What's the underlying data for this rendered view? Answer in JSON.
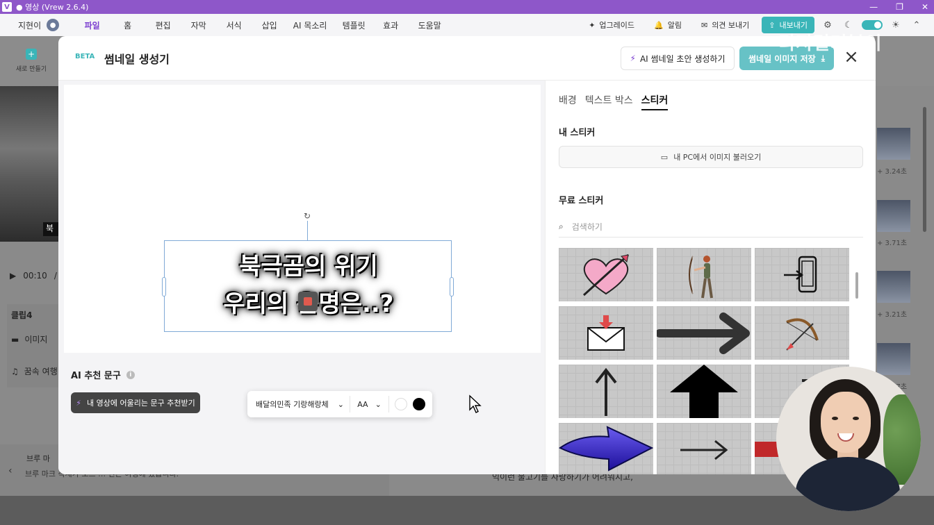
{
  "window": {
    "title": "● 영상 (Vrew 2.6.4)",
    "app_icon": "V"
  },
  "menubar": {
    "user_name": "지현이",
    "menus": [
      "파일",
      "홈",
      "편집",
      "자막",
      "서식",
      "삽입",
      "AI 목소리",
      "템플릿",
      "효과",
      "도움말"
    ],
    "active_menu": "파일",
    "upgrade": "업그레이드",
    "notify": "알림",
    "feedback": "의견 보내기",
    "export": "내보내기"
  },
  "watermark": "디지털거북이",
  "background": {
    "new_label": "새로 만들기",
    "play_time": "00:10",
    "play_sep": "/",
    "video_caption": "북",
    "clip_title": "클립4",
    "clip_image": "이미지",
    "clip_music": "꿈속 여행",
    "bottom_title": "브루 마",
    "bottom_text": "브루 마크 삭제가 모드 … 인근 여행에 있습니다.",
    "right_text": "익이런 불고기를 사랑하기가 어려워지고,",
    "durations": [
      "+ 3.24초",
      "+ 3.71초",
      "+ 3.21초",
      "+ 3.27초"
    ]
  },
  "modal": {
    "beta": "BETA",
    "title": "썸네일 생성기",
    "ai_draft_label": "AI 썸네일 초안 생성하기",
    "save_label": "썸네일 이미지 저장",
    "thumbnail_text": [
      "북극곰의 위기",
      "우리의 운명은..?"
    ],
    "font_name": "배달의민족 기랑해랑체",
    "size_label": "AA",
    "text_color": "#ffffff",
    "stroke_color": "#000000",
    "ai_section_label": "AI 추천 문구",
    "ai_suggest_label": "내 영상에 어울리는 문구 추천받기"
  },
  "side_panel": {
    "tabs": [
      "배경",
      "텍스트 박스",
      "스티커"
    ],
    "active_tab": "스티커",
    "my_stickers_title": "내 스티커",
    "load_from_pc": "내 PC에서 이미지 불러오기",
    "free_stickers_title": "무료 스티커",
    "search_placeholder": "검색하기",
    "stickers": [
      "heart-arrow-sticker",
      "archer-sticker",
      "phone-login-sticker",
      "mail-sticker",
      "arrow-right-thick-sticker",
      "bow-arrow-sticker",
      "arrow-up-outline-sticker",
      "arrow-up-black-sticker",
      "partial-sticker",
      "blue-arrow-sticker",
      "arrow-right-outline-sticker",
      "red-bar-sticker"
    ]
  },
  "colors": {
    "titlebar": "#8e57c9",
    "accent": "#3ab5b8",
    "save_button": "#67c2c6"
  }
}
